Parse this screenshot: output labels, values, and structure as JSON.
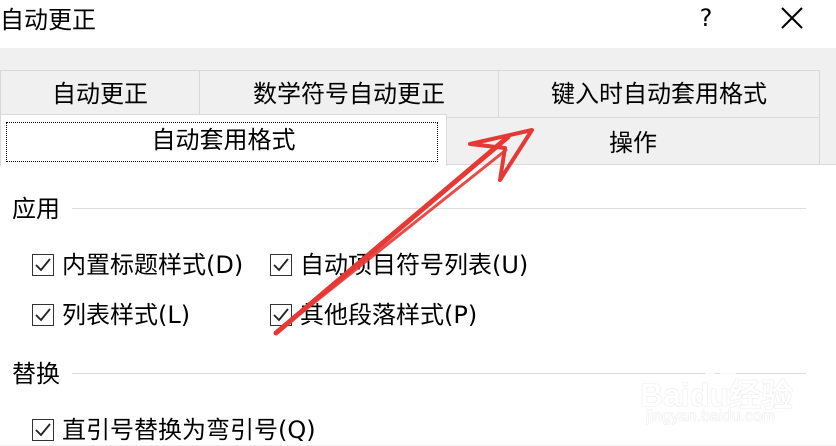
{
  "window": {
    "title": "自动更正",
    "help_label": "?",
    "close_icon": "close-icon"
  },
  "tabs": {
    "row1": [
      {
        "label": "自动更正"
      },
      {
        "label": "数学符号自动更正"
      },
      {
        "label": "键入时自动套用格式"
      }
    ],
    "row2": [
      {
        "label": "自动套用格式",
        "active": true
      },
      {
        "label": "操作"
      }
    ]
  },
  "groups": {
    "apply": {
      "label": "应用",
      "options": [
        {
          "label": "内置标题样式(D)",
          "checked": true
        },
        {
          "label": "自动项目符号列表(U)",
          "checked": true
        },
        {
          "label": "列表样式(L)",
          "checked": true
        },
        {
          "label": "其他段落样式(P)",
          "checked": true
        }
      ]
    },
    "replace": {
      "label": "替换",
      "options": [
        {
          "label": "直引号替换为弯引号(Q)",
          "checked": true
        }
      ]
    }
  },
  "annotation": {
    "color": "#e53935",
    "shape": "red-arrow"
  },
  "watermark": {
    "logo_text": "Baidu经验",
    "url_text": "jingyan.baidu.com"
  }
}
